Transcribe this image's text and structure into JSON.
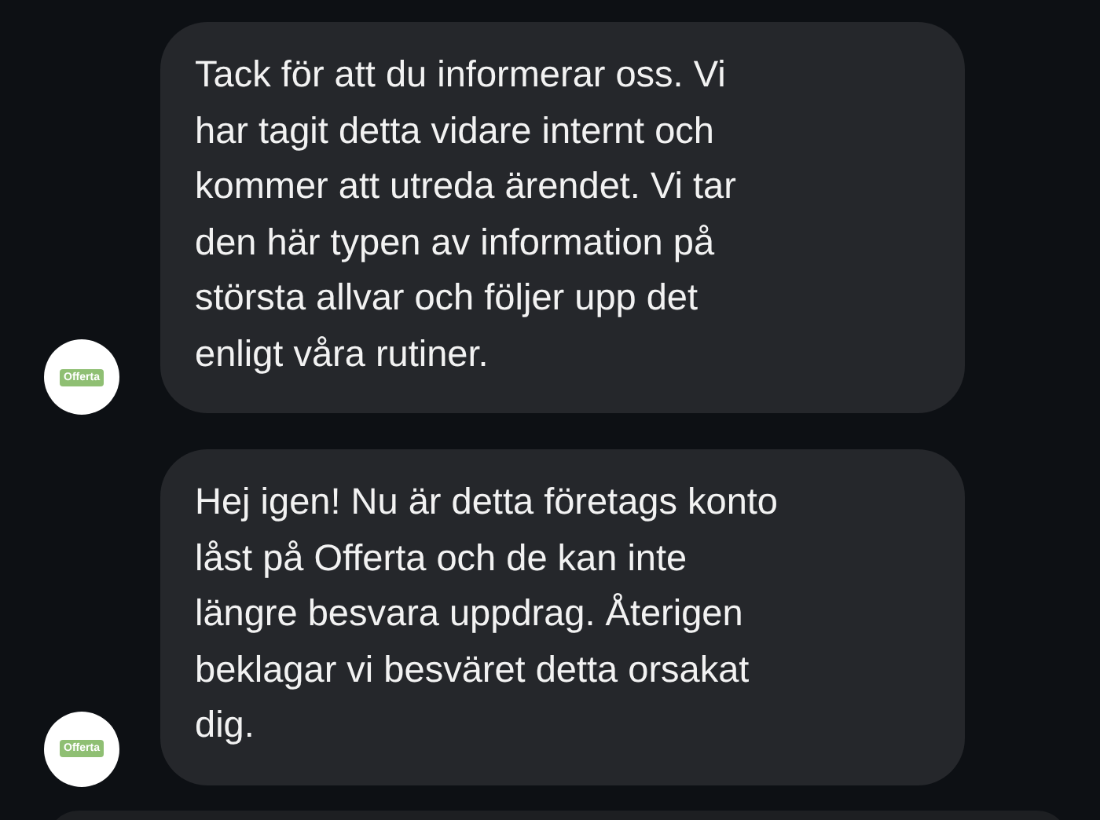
{
  "messages": [
    {
      "sender_logo": "Offerta",
      "text": "Tack för att du informerar oss. Vi\nhar tagit detta vidare internt och\nkommer att utreda ärendet. Vi tar\nden här typen av information på\nstörsta allvar och följer upp det\nenligt våra rutiner."
    },
    {
      "sender_logo": "Offerta",
      "text": "Hej igen! Nu är detta företags konto\nlåst på Offerta och de kan inte\nlängre besvara uppdrag. Återigen\nbeklagar vi besväret detta orsakat\ndig."
    }
  ]
}
